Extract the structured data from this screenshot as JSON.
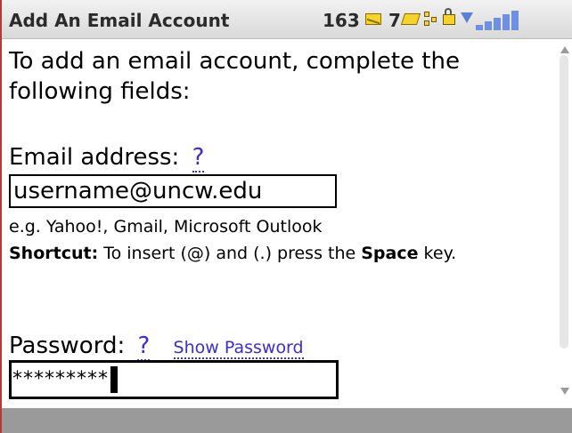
{
  "header": {
    "title": "Add An Email Account",
    "email_count": "163",
    "message_count": "7"
  },
  "content": {
    "intro": "To add an email account, complete the following fields:",
    "email_label": "Email address:",
    "help_link": "?",
    "email_value": "username@uncw.edu",
    "example_text": "e.g. Yahoo!, Gmail, Microsoft Outlook",
    "shortcut_prefix": "Shortcut:",
    "shortcut_text": " To insert (@) and (.) press the ",
    "shortcut_key": "Space",
    "shortcut_suffix": " key.",
    "password_label": "Password:",
    "password_help": "?",
    "show_password": "Show Password",
    "password_value": "*********"
  },
  "icons": [
    "envelope-icon",
    "pin-message-icon",
    "network-icon",
    "lock-icon",
    "wifi-icon",
    "signal-strength-icon"
  ],
  "colors": {
    "link": "#3b2bd8",
    "status_bar": "#d9d9d9",
    "signal": "#6f8fe0",
    "bottom_bar": "#9a9a9a"
  }
}
